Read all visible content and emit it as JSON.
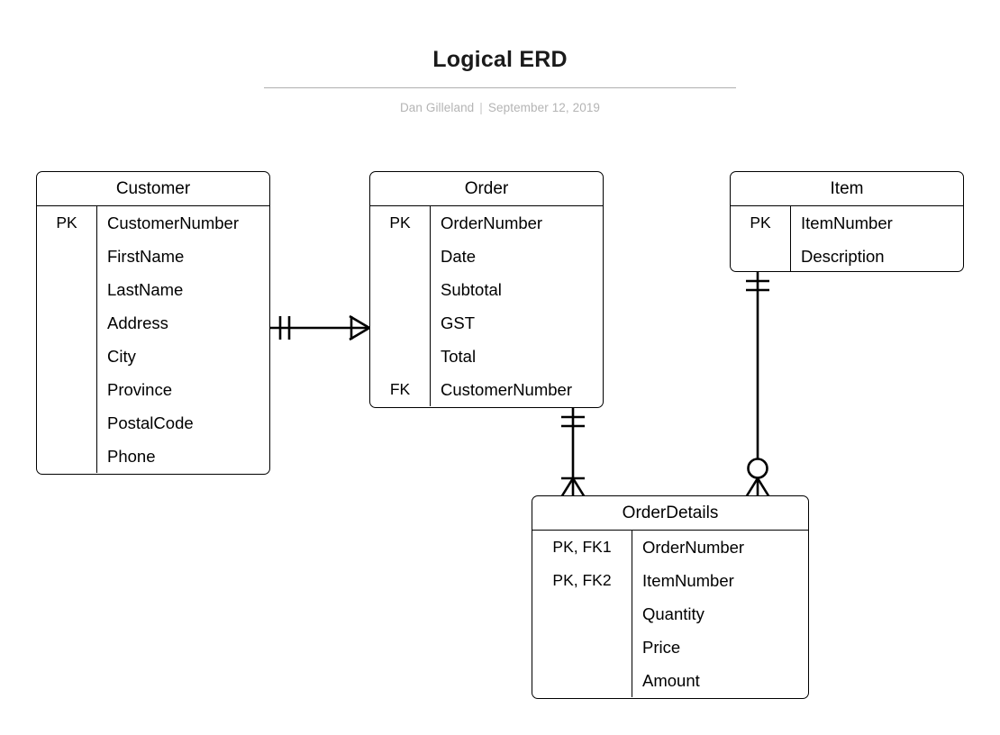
{
  "header": {
    "title": "Logical ERD",
    "author": "Dan Gilleland",
    "separator": "|",
    "date": "September 12, 2019"
  },
  "diagram": {
    "type": "entity-relationship-diagram",
    "notation": "crows-foot",
    "entities": [
      {
        "id": "customer",
        "name": "Customer",
        "attributes": [
          {
            "key": "PK",
            "name": "CustomerNumber"
          },
          {
            "key": "",
            "name": "FirstName"
          },
          {
            "key": "",
            "name": "LastName"
          },
          {
            "key": "",
            "name": "Address"
          },
          {
            "key": "",
            "name": "City"
          },
          {
            "key": "",
            "name": "Province"
          },
          {
            "key": "",
            "name": "PostalCode"
          },
          {
            "key": "",
            "name": "Phone"
          }
        ]
      },
      {
        "id": "order",
        "name": "Order",
        "attributes": [
          {
            "key": "PK",
            "name": "OrderNumber"
          },
          {
            "key": "",
            "name": "Date"
          },
          {
            "key": "",
            "name": "Subtotal"
          },
          {
            "key": "",
            "name": "GST"
          },
          {
            "key": "",
            "name": "Total"
          },
          {
            "key": "FK",
            "name": "CustomerNumber"
          }
        ]
      },
      {
        "id": "item",
        "name": "Item",
        "attributes": [
          {
            "key": "PK",
            "name": "ItemNumber"
          },
          {
            "key": "",
            "name": "Description"
          }
        ]
      },
      {
        "id": "orderdetails",
        "name": "OrderDetails",
        "attributes": [
          {
            "key": "PK, FK1",
            "name": "OrderNumber"
          },
          {
            "key": "PK, FK2",
            "name": "ItemNumber"
          },
          {
            "key": "",
            "name": "Quantity"
          },
          {
            "key": "",
            "name": "Price"
          },
          {
            "key": "",
            "name": "Amount"
          }
        ]
      }
    ],
    "relationships": [
      {
        "id": "customer-order",
        "from": "Customer",
        "to": "Order",
        "from_cardinality": "one and only one",
        "to_cardinality": "one or many"
      },
      {
        "id": "order-orderdetails",
        "from": "Order",
        "to": "OrderDetails",
        "from_cardinality": "one and only one",
        "to_cardinality": "one or many"
      },
      {
        "id": "item-orderdetails",
        "from": "Item",
        "to": "OrderDetails",
        "from_cardinality": "one and only one",
        "to_cardinality": "zero or many"
      }
    ]
  },
  "colors": {
    "line": "#000000",
    "rule": "#b0b0b0",
    "byline": "#b4b4b4",
    "background": "#ffffff"
  }
}
